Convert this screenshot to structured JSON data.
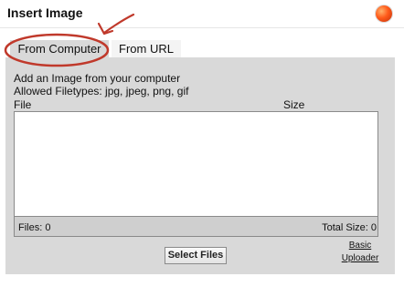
{
  "dialog": {
    "title": "Insert Image"
  },
  "tabs": [
    {
      "label": "From Computer"
    },
    {
      "label": "From URL"
    }
  ],
  "panel": {
    "description_line1": "Add an Image from your computer",
    "description_line2": "Allowed Filetypes: jpg, jpeg, png, gif",
    "columns": {
      "file": "File",
      "size": "Size"
    },
    "footer": {
      "files": "Files: 0",
      "total_size": "Total Size: 0"
    },
    "select_files_label": "Select Files",
    "basic_uploader": {
      "line1": "Basic",
      "line2": "Uploader"
    }
  },
  "colors": {
    "close_button": "#ff5a1a",
    "annotation": "#c0392b"
  }
}
